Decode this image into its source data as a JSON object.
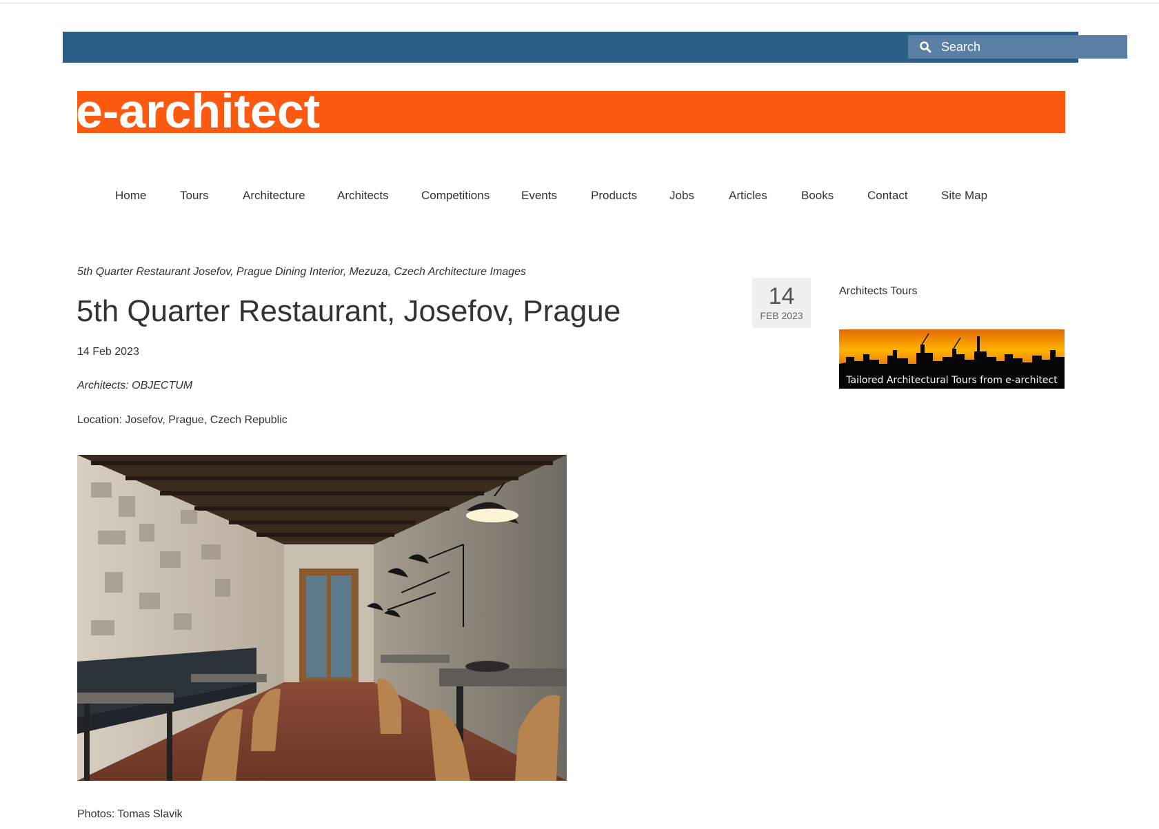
{
  "topbar": {
    "search_placeholder": "Search"
  },
  "brand": {
    "logo_text": "e-architect"
  },
  "nav": {
    "items": [
      "Home",
      "Tours",
      "Architecture",
      "Architects",
      "Competitions",
      "Events",
      "Products",
      "Jobs",
      "Articles",
      "Books",
      "Contact",
      "Site Map"
    ]
  },
  "article": {
    "breadcrumb": "5th Quarter Restaurant Josefov, Prague Dining Interior, Mezuza, Czech Architecture Images",
    "title": "5th Quarter Restaurant, Josefov, Prague",
    "date": "14 Feb 2023",
    "architects": "Architects: OBJECTUM",
    "location": "Location: Josefov, Prague, Czech Republic",
    "photos": "Photos: Tomas Slavik"
  },
  "date_badge": {
    "day": "14",
    "month_year": "FEB 2023"
  },
  "sidebar": {
    "title": "Architects Tours",
    "banner_caption": "Tailored Architectural Tours from e-architect"
  },
  "colors": {
    "topbar": "#2d5d89",
    "search_bg": "#5a7fa5",
    "logo_orange": "#fc5a10",
    "text": "#333333"
  },
  "icons": {
    "search": "search-icon"
  }
}
